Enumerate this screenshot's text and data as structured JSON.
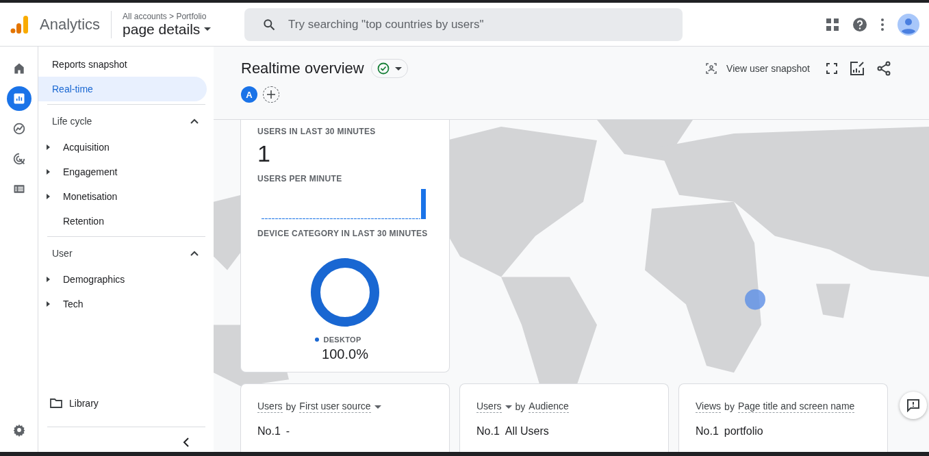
{
  "header": {
    "product": "Analytics",
    "breadcrumb": "All accounts > Portfolio",
    "property": "page details",
    "search": {
      "placeholder": "Try searching \"top countries by users\""
    }
  },
  "rail": [
    {
      "kind": "home",
      "selected": false
    },
    {
      "kind": "reports",
      "selected": true
    },
    {
      "kind": "explore",
      "selected": false
    },
    {
      "kind": "advertising",
      "selected": false
    },
    {
      "kind": "configure",
      "selected": false
    }
  ],
  "nav": {
    "top": [
      {
        "label": "Reports snapshot",
        "selected": false
      },
      {
        "label": "Real-time",
        "selected": true
      }
    ],
    "sections": [
      {
        "label": "Life cycle",
        "expanded": true,
        "items": [
          {
            "label": "Acquisition",
            "expandable": true
          },
          {
            "label": "Engagement",
            "expandable": true
          },
          {
            "label": "Monetisation",
            "expandable": true
          },
          {
            "label": "Retention",
            "expandable": false
          }
        ]
      },
      {
        "label": "User",
        "expanded": true,
        "items": [
          {
            "label": "Demographics",
            "expandable": true
          },
          {
            "label": "Tech",
            "expandable": true
          }
        ]
      }
    ],
    "library": "Library"
  },
  "page": {
    "title": "Realtime overview",
    "comparison_badge": "A",
    "view_user_snapshot": "View user snapshot"
  },
  "summary_card": {
    "users_label": "USERS IN LAST 30 MINUTES",
    "users_value": "1",
    "per_minute_label": "USERS PER MINUTE",
    "device_label": "DEVICE CATEGORY IN LAST 30 MINUTES",
    "legend": [
      {
        "label": "DESKTOP",
        "value": "100.0%",
        "color": "#1967d2"
      }
    ]
  },
  "cards": [
    {
      "metric": "Users",
      "metric_menu": false,
      "connector": "by",
      "dimension": "First user source",
      "dimension_menu": true,
      "rank": "No.1",
      "value": "-"
    },
    {
      "metric": "Users",
      "metric_menu": true,
      "connector": "by",
      "dimension": "Audience",
      "dimension_menu": false,
      "rank": "No.1",
      "value": "All Users"
    },
    {
      "metric": "Views",
      "metric_menu": false,
      "connector": "by",
      "dimension": "Page title and screen name",
      "dimension_menu": false,
      "rank": "No.1",
      "value": "portfolio"
    }
  ]
}
